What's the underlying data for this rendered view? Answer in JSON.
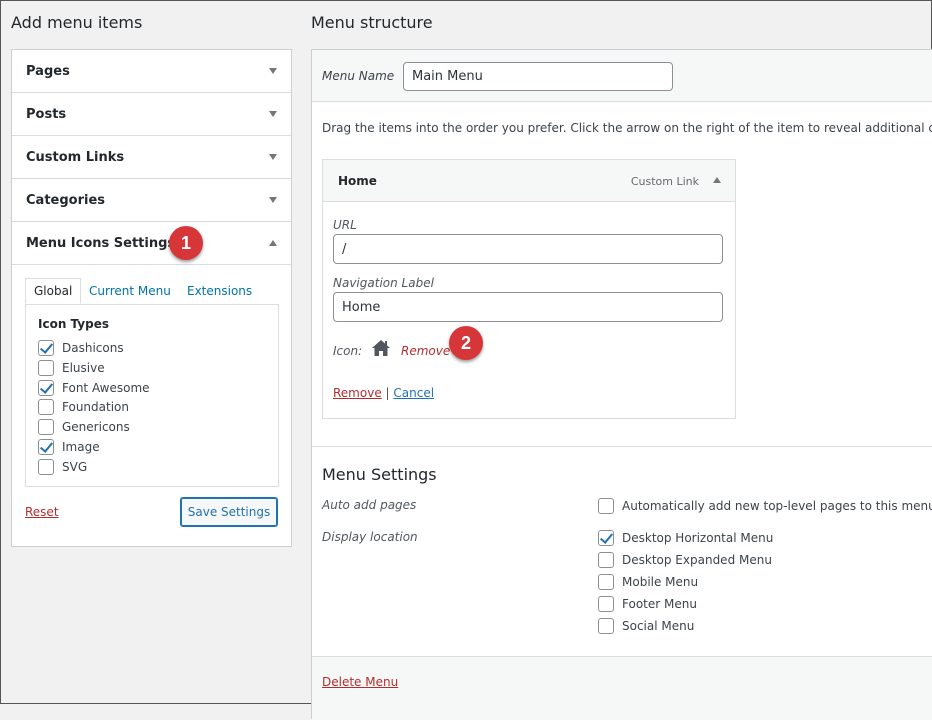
{
  "left": {
    "title": "Add menu items",
    "accordion": [
      {
        "label": "Pages"
      },
      {
        "label": "Posts"
      },
      {
        "label": "Custom Links"
      },
      {
        "label": "Categories"
      },
      {
        "label": "Menu Icons Settings"
      }
    ],
    "tabs": [
      "Global",
      "Current Menu",
      "Extensions"
    ],
    "icon_types_label": "Icon Types",
    "icon_types": [
      {
        "label": "Dashicons",
        "checked": true
      },
      {
        "label": "Elusive",
        "checked": false
      },
      {
        "label": "Font Awesome",
        "checked": true
      },
      {
        "label": "Foundation",
        "checked": false
      },
      {
        "label": "Genericons",
        "checked": false
      },
      {
        "label": "Image",
        "checked": true
      },
      {
        "label": "SVG",
        "checked": false
      }
    ],
    "reset_label": "Reset",
    "save_label": "Save Settings"
  },
  "badges": [
    "1",
    "2"
  ],
  "right": {
    "title": "Menu structure",
    "menu_name_label": "Menu Name",
    "menu_name_value": "Main Menu",
    "instructions": "Drag the items into the order you prefer. Click the arrow on the right of the item to reveal additional config",
    "item": {
      "title": "Home",
      "type": "Custom Link",
      "url_label": "URL",
      "url_value": "/",
      "nav_label": "Navigation Label",
      "nav_value": "Home",
      "icon_label": "Icon:",
      "icon_remove": "Remove",
      "remove_link": "Remove",
      "separator": "|",
      "cancel_link": "Cancel"
    },
    "settings": {
      "title": "Menu Settings",
      "auto_add_label": "Auto add pages",
      "auto_add_option": {
        "label": "Automatically add new top-level pages to this menu",
        "checked": false
      },
      "display_location_label": "Display location",
      "locations": [
        {
          "label": "Desktop Horizontal Menu",
          "checked": true
        },
        {
          "label": "Desktop Expanded Menu",
          "checked": false
        },
        {
          "label": "Mobile Menu",
          "checked": false
        },
        {
          "label": "Footer Menu",
          "checked": false
        },
        {
          "label": "Social Menu",
          "checked": false
        }
      ]
    },
    "delete_menu": "Delete Menu"
  },
  "colors": {
    "badge": "#d63638",
    "link": "#2271b1",
    "danger": "#b32d2e"
  }
}
